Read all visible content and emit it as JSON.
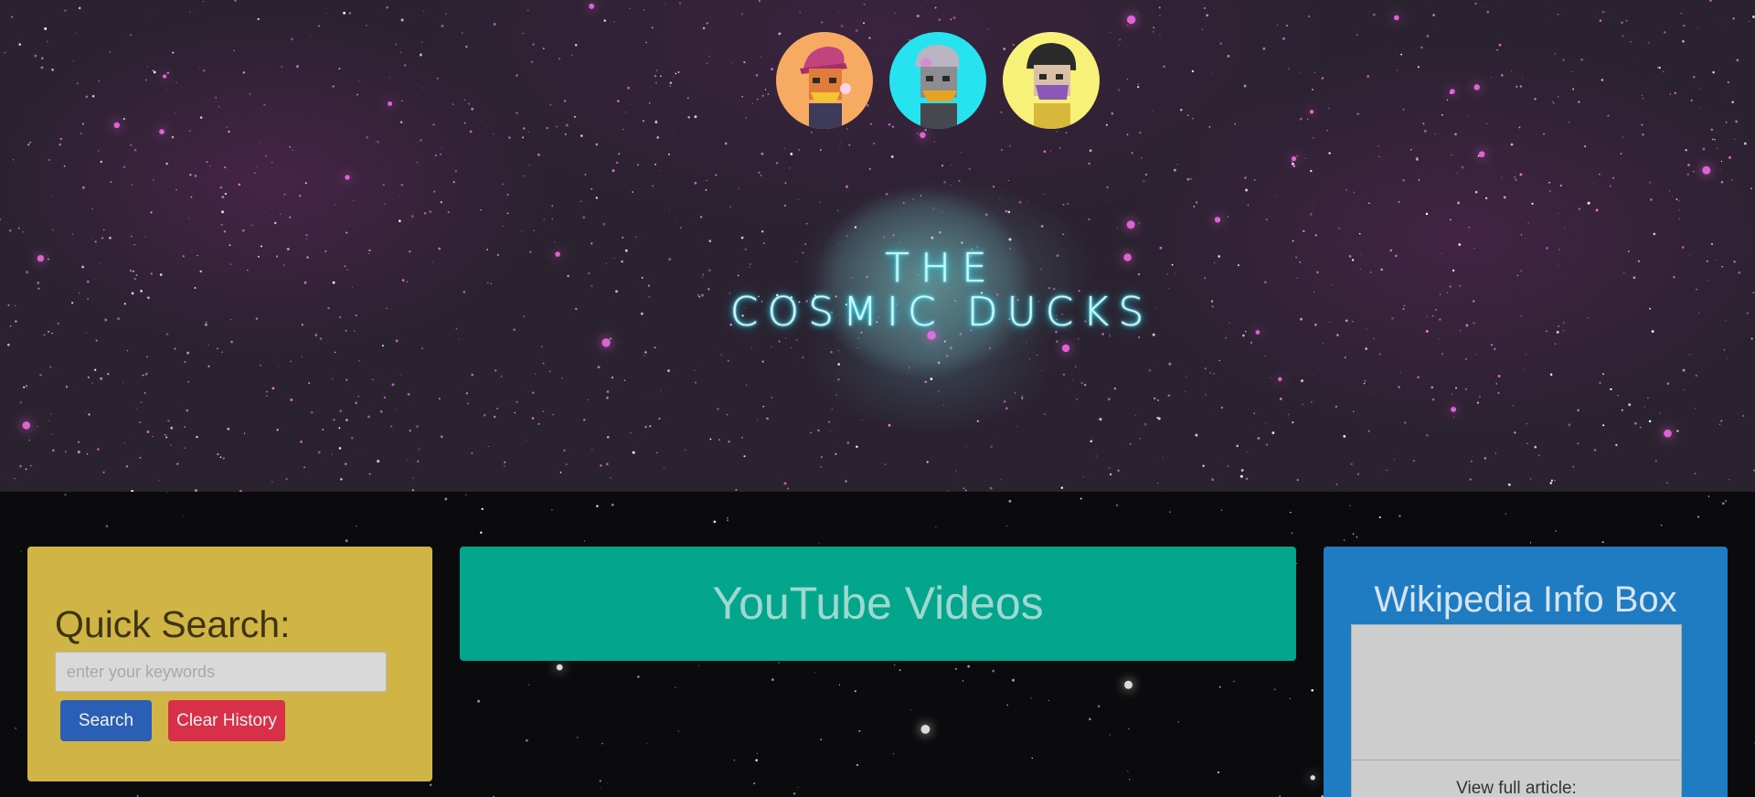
{
  "hero": {
    "logo_line1": "THE",
    "logo_line2": "COSMIC DUCKS",
    "avatars": [
      {
        "icon": "duck-avatar-pink-cap-icon",
        "bg": "#f7ab62"
      },
      {
        "icon": "duck-avatar-gray-hair-icon",
        "bg": "#27e3f0"
      },
      {
        "icon": "duck-avatar-mask-icon",
        "bg": "#f7f17a"
      }
    ]
  },
  "search": {
    "title": "Quick Search:",
    "placeholder": "enter your keywords",
    "search_label": "Search",
    "clear_label": "Clear History",
    "colors": {
      "panel": "#d0b445",
      "search_button": "#2b5fb5",
      "clear_button": "#d9304a"
    }
  },
  "youtube": {
    "title": "YouTube Videos",
    "color": "#03a58d"
  },
  "wiki": {
    "title": "Wikipedia Info Box",
    "link_label": "View full article:",
    "color": "#1f7cc2"
  }
}
